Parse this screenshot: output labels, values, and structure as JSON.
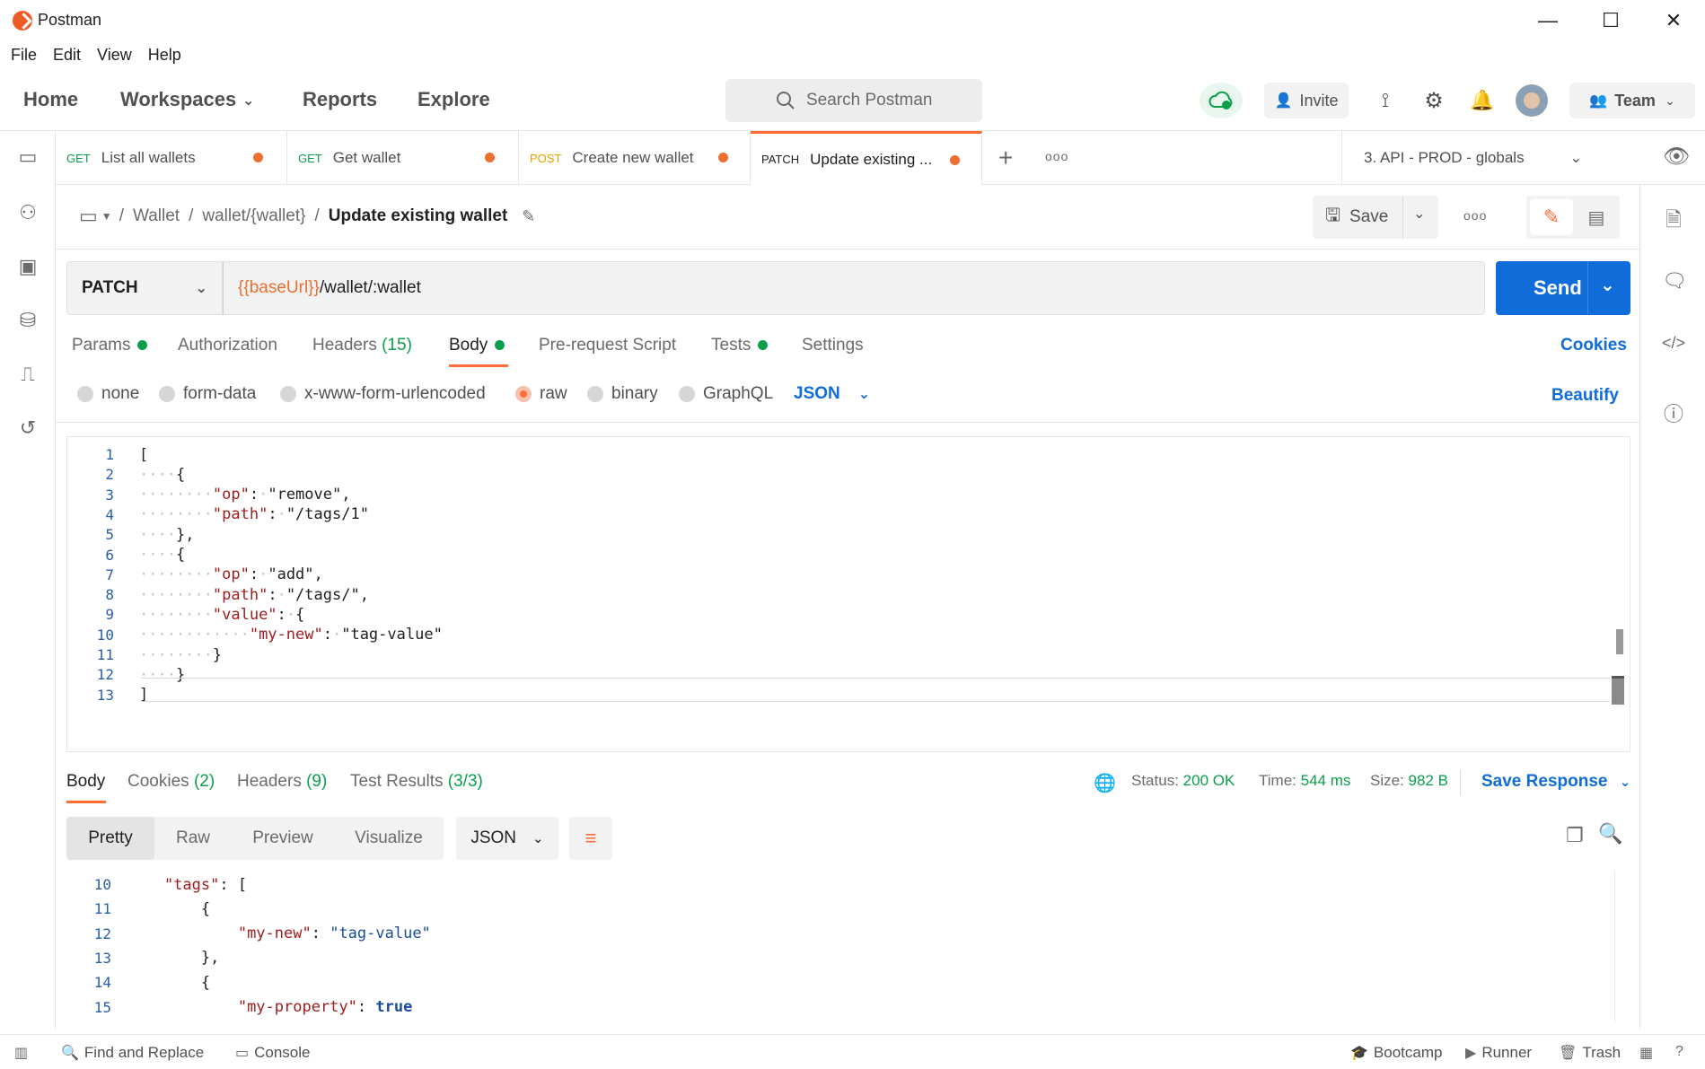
{
  "window": {
    "title": "Postman",
    "minimize_glyph": "—",
    "maximize_glyph": "☐",
    "close_glyph": "✕"
  },
  "menu": [
    "File",
    "Edit",
    "View",
    "Help"
  ],
  "header": {
    "nav": [
      "Home",
      "Workspaces",
      "Reports",
      "Explore"
    ],
    "search_placeholder": "Search Postman",
    "invite_label": "Invite",
    "team_label": "Team"
  },
  "tabs": [
    {
      "method": "GET",
      "method_color": "#0a9f4a",
      "title": "List all wallets"
    },
    {
      "method": "GET",
      "method_color": "#0a9f4a",
      "title": "Get wallet"
    },
    {
      "method": "POST",
      "method_color": "#e6a100",
      "title": "Create new wallet"
    },
    {
      "method": "PATCH",
      "method_color": "#212121",
      "title": "Update existing ..."
    }
  ],
  "environment": {
    "selected": "3. API - PROD - globals"
  },
  "breadcrumb": {
    "parts": [
      "Wallet",
      "wallet/{wallet}"
    ],
    "current": "Update existing wallet",
    "separator": "/"
  },
  "actions": {
    "save_label": "Save",
    "more_label": "ooo"
  },
  "request": {
    "method": "PATCH",
    "url_variable": "{{baseUrl}}",
    "url_path": "/wallet/:wallet",
    "send_label": "Send",
    "tabs": {
      "params": "Params",
      "authorization": "Authorization",
      "headers": "Headers",
      "headers_count": "(15)",
      "body": "Body",
      "prerequest": "Pre-request Script",
      "tests": "Tests",
      "settings": "Settings",
      "cookies": "Cookies"
    },
    "body_types": [
      "none",
      "form-data",
      "x-www-form-urlencoded",
      "raw",
      "binary",
      "GraphQL"
    ],
    "selected_body_type": "raw",
    "format": "JSON",
    "beautify_label": "Beautify"
  },
  "request_body_lines": [
    {
      "n": "1",
      "text": "["
    },
    {
      "n": "2",
      "text": "····{"
    },
    {
      "n": "3",
      "text": "········\"op\":·\"remove\","
    },
    {
      "n": "4",
      "text": "········\"path\":·\"/tags/1\""
    },
    {
      "n": "5",
      "text": "····},"
    },
    {
      "n": "6",
      "text": "····{"
    },
    {
      "n": "7",
      "text": "········\"op\":·\"add\","
    },
    {
      "n": "8",
      "text": "········\"path\":·\"/tags/\","
    },
    {
      "n": "9",
      "text": "········\"value\":·{"
    },
    {
      "n": "10",
      "text": "············\"my-new\":·\"tag-value\""
    },
    {
      "n": "11",
      "text": "········}"
    },
    {
      "n": "12",
      "text": "····}"
    },
    {
      "n": "13",
      "text": "]"
    }
  ],
  "response": {
    "tabs": {
      "body": "Body",
      "cookies": "Cookies",
      "cookies_count": "(2)",
      "headers": "Headers",
      "headers_count": "(9)",
      "tests": "Test Results",
      "tests_count": "(3/3)"
    },
    "status_label": "Status:",
    "status_value": "200 OK",
    "time_label": "Time:",
    "time_value": "544 ms",
    "size_label": "Size:",
    "size_value": "982 B",
    "save_label": "Save Response",
    "views": [
      "Pretty",
      "Raw",
      "Preview",
      "Visualize"
    ],
    "format": "JSON"
  },
  "response_body_lines": [
    {
      "n": "10",
      "text": "    \"tags\": ["
    },
    {
      "n": "11",
      "text": "        {"
    },
    {
      "n": "12",
      "text": "            \"my-new\": \"tag-value\""
    },
    {
      "n": "13",
      "text": "        },"
    },
    {
      "n": "14",
      "text": "        {"
    },
    {
      "n": "15",
      "text": "            \"my-property\": true"
    }
  ],
  "statusbar": {
    "find_replace": "Find and Replace",
    "console": "Console",
    "bootcamp": "Bootcamp",
    "runner": "Runner",
    "trash": "Trash"
  },
  "colors": {
    "accent": "#ff6c37",
    "send": "#0f6cd8",
    "success": "#0a9f4a"
  }
}
